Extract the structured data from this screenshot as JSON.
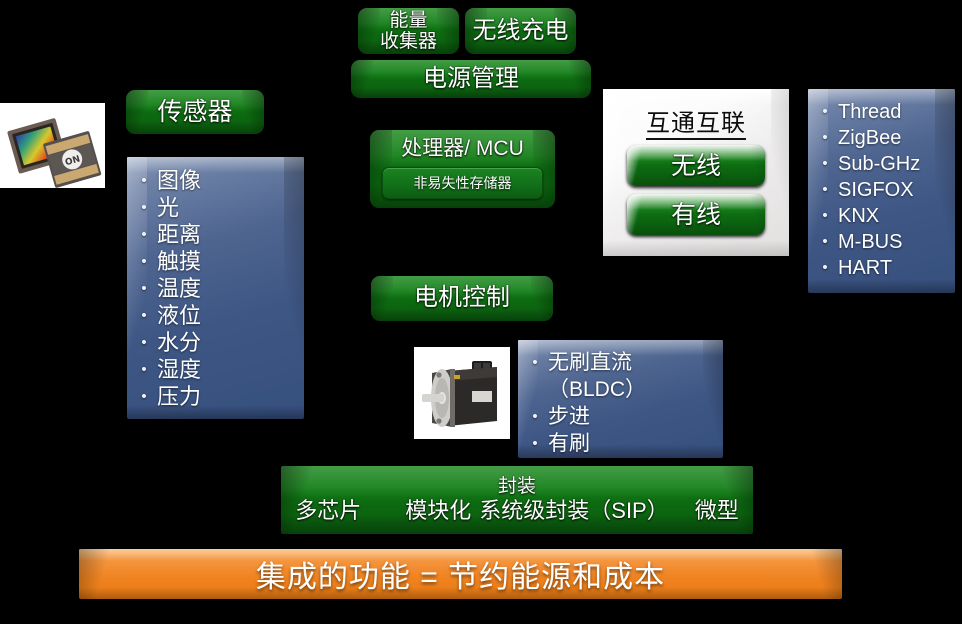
{
  "diagram": {
    "title_bar": {
      "text": "集成的功能  =  节约能源和成本",
      "color": "#ef8320"
    },
    "power": {
      "energy_harvester": "能量\n收集器",
      "energy_harvester_line1": "能量",
      "energy_harvester_line2": "收集器",
      "wireless_charging": "无线充电",
      "power_management": "电源管理"
    },
    "sensors": {
      "header": "传感器",
      "items": [
        "图像",
        "光",
        "距离",
        "触摸",
        "温度",
        "液位",
        "水分",
        "湿度",
        "压力"
      ],
      "photo_caption": "ON"
    },
    "processor": {
      "header": "处理器/ MCU",
      "nvm": "非易失性存储器"
    },
    "connectivity": {
      "header": "互通互联",
      "wireless": "无线",
      "wired": "有线",
      "protocols": [
        "Thread",
        "ZigBee",
        "Sub-GHz",
        "SIGFOX",
        "KNX",
        "M-BUS",
        "HART"
      ]
    },
    "motor": {
      "header": "电机控制",
      "items": [
        "无刷直流\n（BLDC）",
        "步进",
        "有刷"
      ],
      "item_1_line1": "无刷直流",
      "item_1_line2": "（BLDC）",
      "item_2": "步进",
      "item_3": "有刷"
    },
    "packaging": {
      "title": "封装",
      "options": [
        "多芯片",
        "模块化",
        "系统级封装（SIP）",
        "微型"
      ],
      "opt_1": "多芯片",
      "opt_2": "模块化",
      "opt_3": "系统级封装（SIP）",
      "opt_4": "微型"
    },
    "colors": {
      "background": "#000000",
      "green": "#11751a",
      "blue": "#40598a",
      "orange": "#ef8320",
      "silver": "#f2f0ef"
    }
  }
}
